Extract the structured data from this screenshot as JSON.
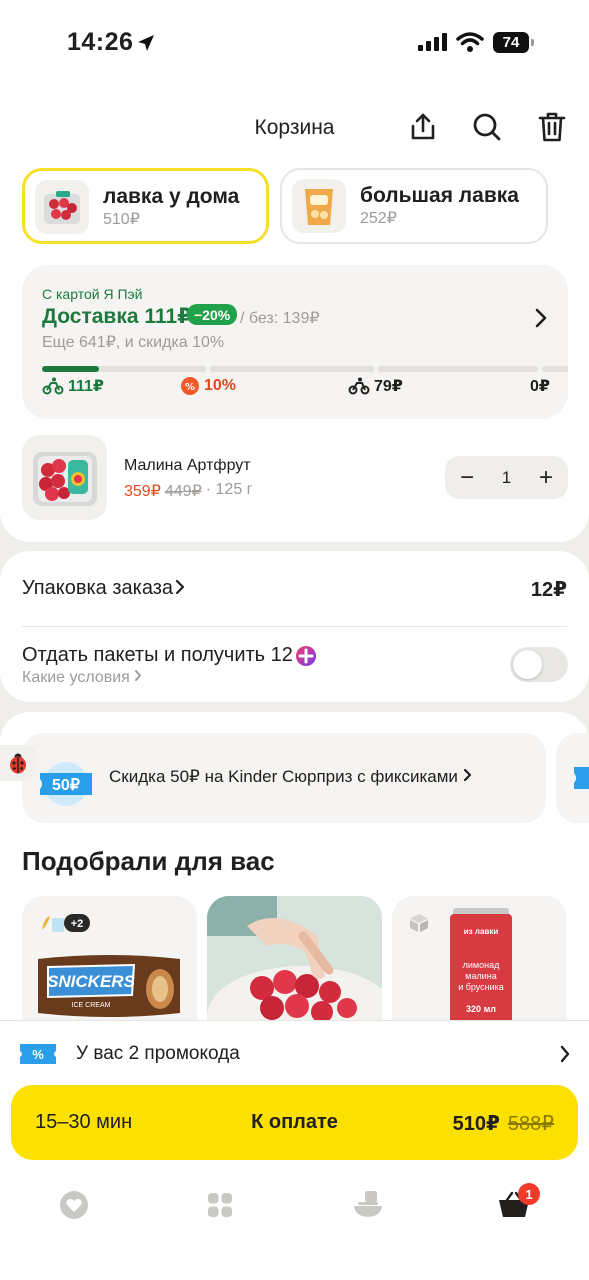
{
  "status_bar": {
    "time": "14:26",
    "battery": "74"
  },
  "header": {
    "title": "Корзина"
  },
  "stores": [
    {
      "name": "лавка у дома",
      "price": "510₽",
      "active": true
    },
    {
      "name": "большая лавка",
      "price": "252₽",
      "active": false
    }
  ],
  "delivery": {
    "card_note": "С картой Я Пэй",
    "title": "Доставка 111₽",
    "discount_badge": "−20%",
    "without_card": "/ без: 139₽",
    "more_hint": "Еще 641₽, и скидка 10%",
    "progress_fraction": 0.55,
    "tiers": [
      "111₽",
      "10%",
      "79₽",
      "0₽"
    ]
  },
  "cart_item": {
    "name": "Малина Артфрут",
    "price": "359₽",
    "old_price": "449₽",
    "weight": "· 125 г",
    "quantity": "1"
  },
  "packaging": {
    "label": "Упаковка заказа",
    "price": "12₽",
    "return_bags_label": "Отдать пакеты и получить 12",
    "conditions_link": "Какие условия",
    "toggle_on": false
  },
  "promo_banner": {
    "tag": "50₽",
    "text": "Скидка 50₽ на Kinder Сюрприз с фиксиками",
    "next_tag_partial": "1"
  },
  "recommendations": {
    "title": "Подобрали для вас",
    "cards": [
      {
        "name": "SNICKERS",
        "subtitle": "ICE CREAM",
        "badge": "+2"
      },
      {
        "name": "Малина"
      },
      {
        "name": "лимонад малина и брусника",
        "brand": "из лавки",
        "volume": "320 мл"
      }
    ]
  },
  "bottom_sheet": {
    "promocodes_text": "У вас 2 промокода",
    "eta": "15–30 мин",
    "pay_label": "К оплате",
    "total": "510₽",
    "old_total": "588₽",
    "cart_badge": "1"
  },
  "colors": {
    "accent_yellow": "#fce000",
    "green": "#1d7a3e",
    "discount_red": "#e4471f",
    "badge_red": "#f23a2a"
  }
}
